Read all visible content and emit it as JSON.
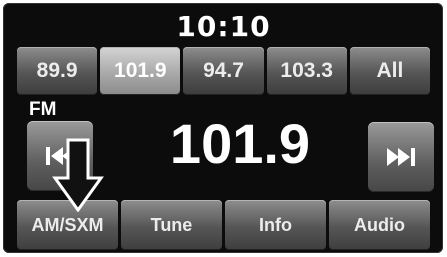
{
  "clock": {
    "time": "10:10"
  },
  "presets": [
    {
      "label": "89.9",
      "active": false
    },
    {
      "label": "101.9",
      "active": true
    },
    {
      "label": "94.7",
      "active": false
    },
    {
      "label": "103.3",
      "active": false
    },
    {
      "label": "All",
      "active": false
    }
  ],
  "station": {
    "band": "FM",
    "frequency": "101.9"
  },
  "controls": {
    "seek_down_icon": "seek-previous-icon",
    "seek_up_icon": "seek-next-icon",
    "callout_icon": "down-arrow-icon"
  },
  "bottom_bar": [
    {
      "label": "AM/SXM"
    },
    {
      "label": "Tune"
    },
    {
      "label": "Info"
    },
    {
      "label": "Audio"
    }
  ]
}
